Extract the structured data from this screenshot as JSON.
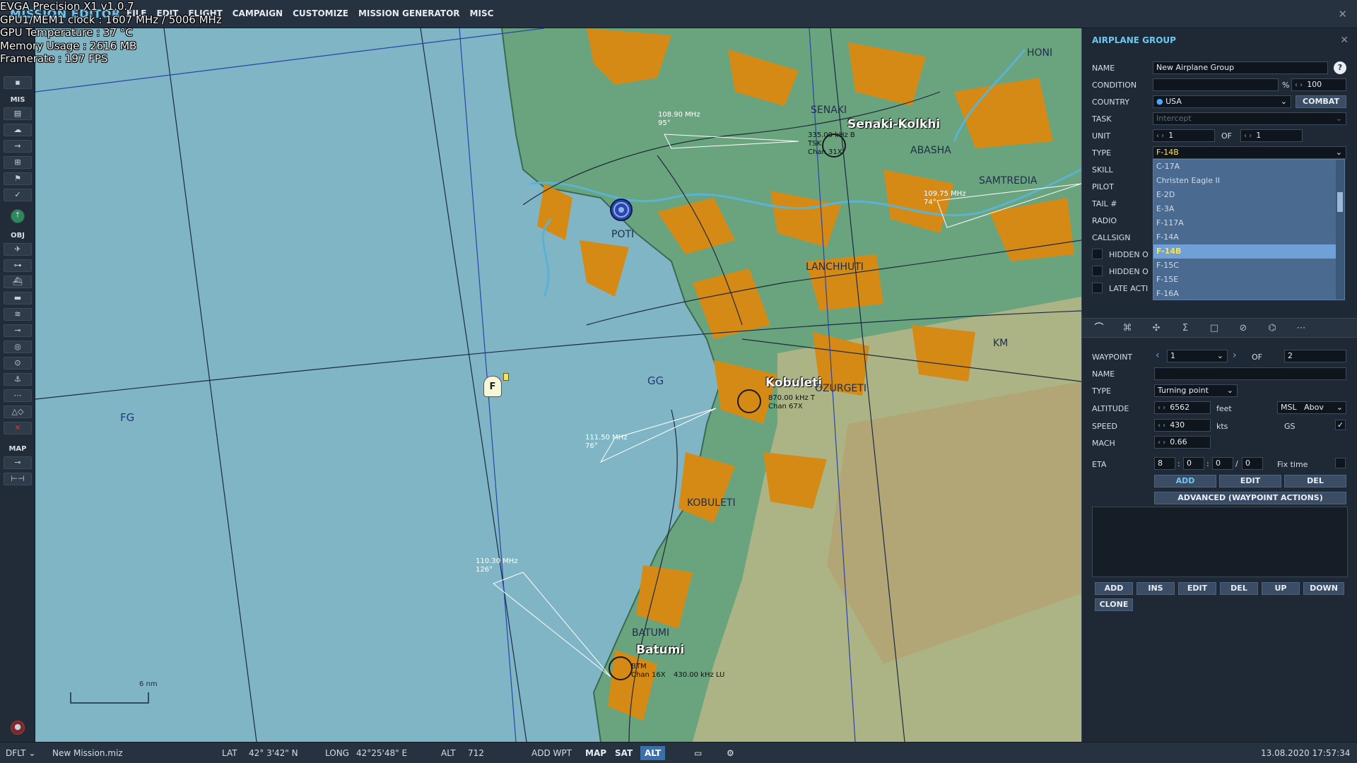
{
  "overlay": {
    "line1": "EVGA Precision X1  v1.0.7",
    "line2": "GPU1/MEM1 clock : 1607 MHz / 5006 MHz",
    "line3": "GPU Temperature : 37 °C",
    "line4": "Memory Usage : 2616 MB",
    "line5": "Framerate : 197 FPS"
  },
  "app": {
    "title": "MISSION EDITOR"
  },
  "menu": {
    "items": [
      "FILE",
      "EDIT",
      "FLIGHT",
      "CAMPAIGN",
      "CUSTOMIZE",
      "MISSION GENERATOR",
      "MISC"
    ]
  },
  "toolbar": {
    "mis": "MIS",
    "obj": "OBJ",
    "map": "MAP"
  },
  "map": {
    "labels": {
      "honi": "HONI",
      "senaki": "SENAKI",
      "senaki_kolkhi": "Senaki-Kolkhi",
      "abasha": "ABASHA",
      "samtredia": "SAMTREDIA",
      "poti": "POTI",
      "lanchhuti": "LANCHHUTI",
      "km": "KM",
      "gg": "GG",
      "fg": "FG",
      "kobuleti_city": "Kobuleti",
      "ozurgeti": "OZURGETI",
      "kobuleti": "KOBULETI",
      "batumi_upper": "BATUMI",
      "batumi": "Batumi"
    },
    "freqs": {
      "f1": "108.90 MHz",
      "f1d": "95°",
      "f2": "109.75 MHz",
      "f2d": "74°",
      "f3": "111.50 MHz",
      "f3d": "76°",
      "f4": "110.30 MHz",
      "f4d": "126°",
      "senaki_beacon": "335.00 kHz B",
      "senaki_tsk": "TSK",
      "senaki_chan": "Chan 31X",
      "kob_beacon": "870.00 kHz T",
      "kob_chan": "Chan 67X",
      "btm": "BTM",
      "btm_chan": "Chan 16X",
      "btm_beacon": "430.00 kHz LU"
    },
    "scale": "6 nm",
    "group_marker": "F"
  },
  "panel": {
    "title": "AIRPLANE GROUP",
    "help": "?",
    "labels": {
      "name": "NAME",
      "condition": "CONDITION",
      "country": "COUNTRY",
      "task": "TASK",
      "unit": "UNIT",
      "type": "TYPE",
      "skill": "SKILL",
      "pilot": "PILOT",
      "tail": "TAIL #",
      "radio": "RADIO",
      "callsign": "CALLSIGN",
      "hidden1": "HIDDEN O",
      "hidden2": "HIDDEN O",
      "late": "LATE ACTI"
    },
    "values": {
      "name": "New Airplane Group",
      "condition_pct": "%",
      "condition": "100",
      "country": "USA",
      "combat": "COMBAT",
      "task": "Intercept",
      "unit": "1",
      "unit_of": "OF",
      "unit_total": "1",
      "type": "F-14B"
    },
    "type_list": [
      "C-17A",
      "Christen Eagle II",
      "E-2D",
      "E-3A",
      "F-117A",
      "F-14A",
      "F-14B",
      "F-15C",
      "F-15E",
      "F-16A"
    ],
    "type_selected": "F-14B",
    "waypoint": {
      "labels": {
        "waypoint": "WAYPOINT",
        "name": "NAME",
        "type": "TYPE",
        "altitude": "ALTITUDE",
        "speed": "SPEED",
        "mach": "MACH",
        "eta": "ETA"
      },
      "wp": "1",
      "of": "OF",
      "total": "2",
      "type": "Turning point",
      "altitude": "6562",
      "alt_unit": "feet",
      "alt_ref": "MSL",
      "alt_mode": "Abov",
      "speed": "430",
      "speed_unit": "kts",
      "gs": "GS",
      "mach": "0.66",
      "eta_d": "8",
      "eta_h": "0",
      "eta_m": "0",
      "eta_s": "0",
      "fix_time": "Fix time",
      "add": "ADD",
      "edit": "EDIT",
      "del": "DEL",
      "advanced": "ADVANCED (WAYPOINT ACTIONS)"
    },
    "actions": {
      "add": "ADD",
      "ins": "INS",
      "edit": "EDIT",
      "del": "DEL",
      "up": "UP",
      "down": "DOWN",
      "clone": "CLONE"
    }
  },
  "status": {
    "profile": "DFLT",
    "file": "New Mission.miz",
    "lat_label": "LAT",
    "lat": "42° 3'42\" N",
    "long_label": "LONG",
    "long": "42°25'48\" E",
    "alt_label": "ALT",
    "alt": "712",
    "add_wpt": "ADD WPT",
    "map": "MAP",
    "sat": "SAT",
    "alt_btn": "ALT",
    "datetime": "13.08.2020 17:57:34"
  },
  "colors": {
    "accent": "#6fc6ee",
    "sea": "#7fb5c4",
    "land": "#6aa47e",
    "urban": "#d68a16",
    "selected": "#ffe24a"
  }
}
